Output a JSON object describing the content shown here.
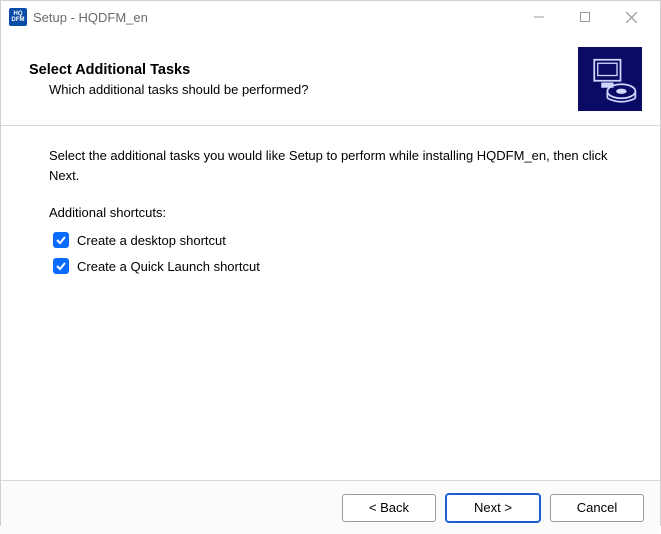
{
  "titlebar": {
    "icon_top": "HQ",
    "icon_bottom": "DFM",
    "title": "Setup - HQDFM_en"
  },
  "header": {
    "heading": "Select Additional Tasks",
    "subheading": "Which additional tasks should be performed?"
  },
  "content": {
    "instruction": "Select the additional tasks you would like Setup to perform while installing HQDFM_en, then click Next.",
    "group_label": "Additional shortcuts:",
    "checks": [
      {
        "label": "Create a desktop shortcut",
        "checked": true
      },
      {
        "label": "Create a Quick Launch shortcut",
        "checked": true
      }
    ]
  },
  "footer": {
    "back": "< Back",
    "next": "Next >",
    "cancel": "Cancel"
  }
}
